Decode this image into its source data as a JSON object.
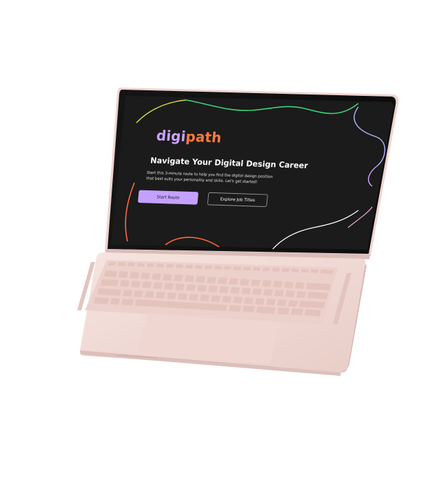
{
  "hero": {
    "logo_part1": "digi",
    "logo_part2": "path",
    "headline": "Navigate Your Digital Design Career",
    "description": "Start this 3-minute route to help you find the digital design position that best suits your personality and skills. Let's get started!",
    "primary_button_label": "Start Route",
    "secondary_button_label": "Explore Job Titles"
  },
  "colors": {
    "screen_background": "#1b1b1b",
    "logo_digi": "#c9a3ff",
    "logo_path": "#ff7a3d",
    "primary_button": "#c4a1ff",
    "laptop_body": "#f0d9d4",
    "keyboard": "#ebcdc8"
  },
  "icons": {
    "decor_lines": "wavy-lines-decoration"
  }
}
